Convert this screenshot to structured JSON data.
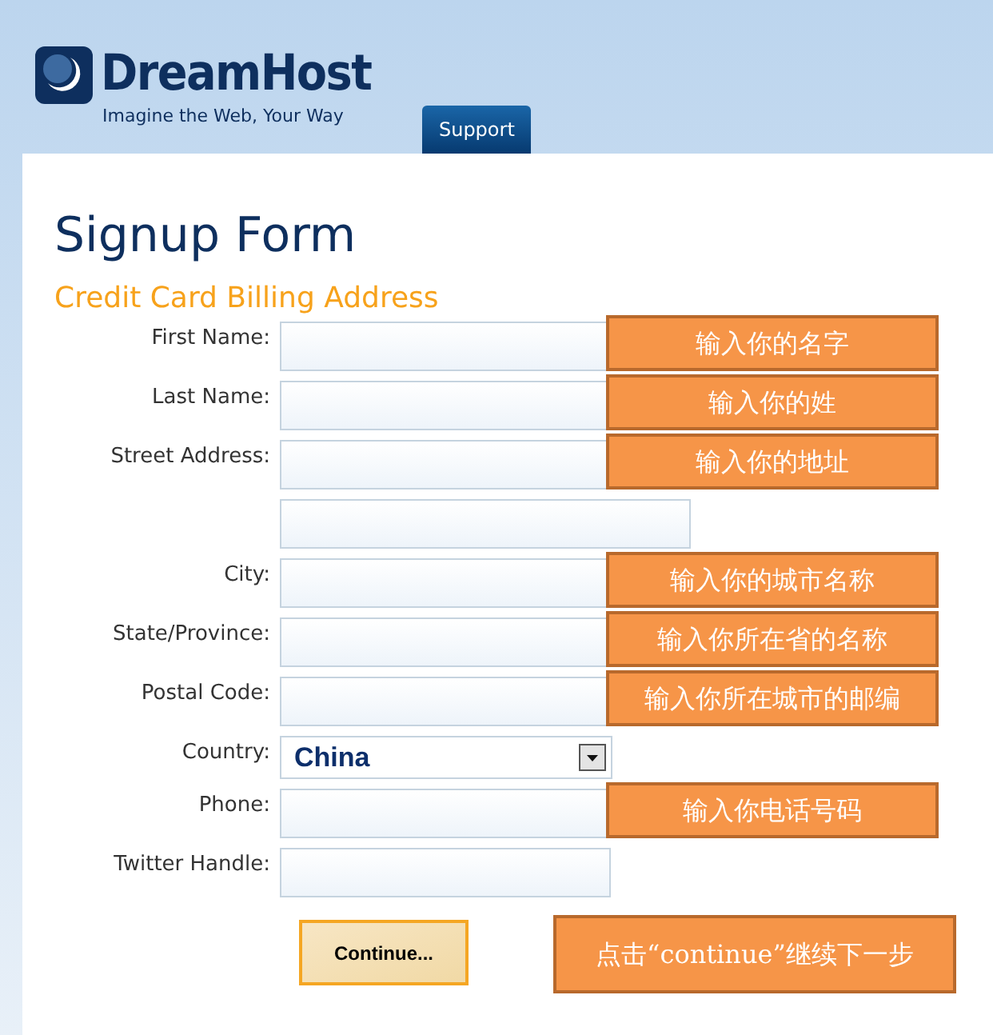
{
  "header": {
    "logo": "DreamHost",
    "tagline": "Imagine the Web, Your Way",
    "tab": "Support"
  },
  "title": "Signup Form",
  "subtitle": "Credit Card Billing Address",
  "rows": [
    {
      "kind": "text",
      "label": "First Name:",
      "note": "输入你的名字"
    },
    {
      "kind": "text",
      "label": "Last Name:",
      "note": "输入你的姓"
    },
    {
      "kind": "text",
      "label": "Street Address:",
      "note": "输入你的地址"
    },
    {
      "kind": "wide"
    },
    {
      "kind": "text",
      "label": "City:",
      "note": "输入你的城市名称"
    },
    {
      "kind": "text",
      "label": "State/Province:",
      "note": "输入你所在省的名称"
    },
    {
      "kind": "text",
      "label": "Postal Code:",
      "note": "输入你所在城市的邮编"
    },
    {
      "kind": "select",
      "label": "Country:",
      "value": "China"
    },
    {
      "kind": "text",
      "label": "Phone:",
      "note": "输入你电话号码"
    },
    {
      "kind": "text",
      "label": "Twitter Handle:"
    }
  ],
  "button": {
    "label": "Continue...",
    "note": "点击“continue”继续下一步"
  }
}
